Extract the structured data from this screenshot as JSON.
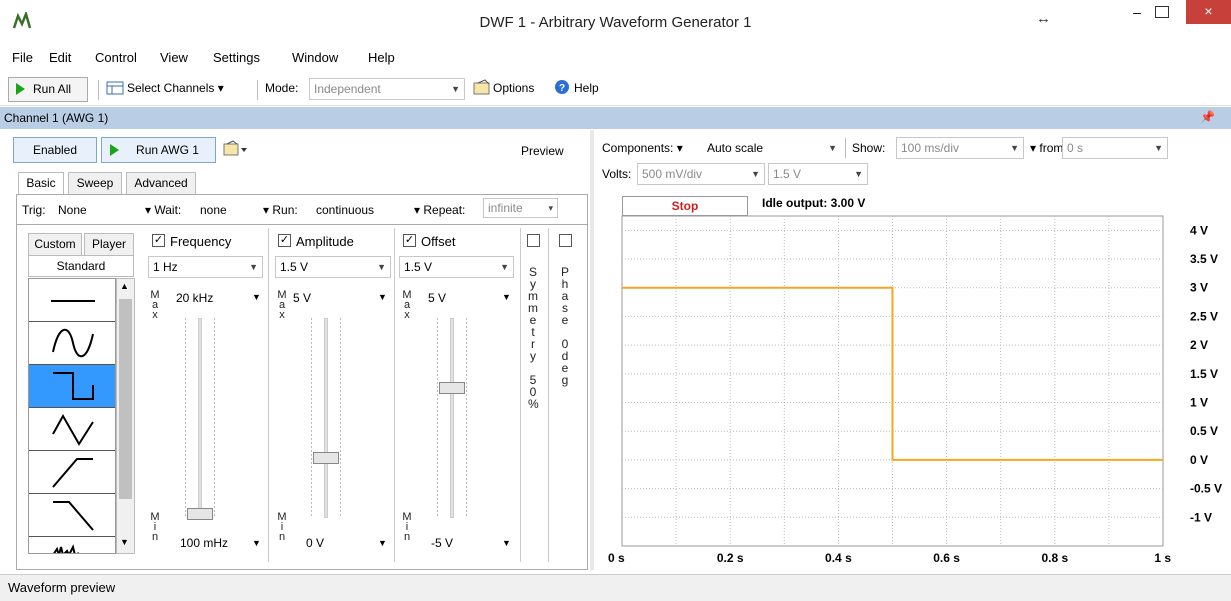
{
  "window": {
    "title": "DWF 1 - Arbitrary Waveform Generator 1",
    "close": "×",
    "resize": "↔",
    "minimize": "–"
  },
  "menu": [
    "File",
    "Edit",
    "Control",
    "View",
    "Settings",
    "Window",
    "Help"
  ],
  "toolbar": {
    "run_all": "Run All",
    "select_channels": "Select Channels",
    "mode_label": "Mode:",
    "mode_value": "Independent",
    "options": "Options",
    "help": "Help"
  },
  "channel": {
    "title": "Channel 1 (AWG 1)",
    "enabled": "Enabled",
    "run": "Run AWG 1",
    "preview": "Preview",
    "tabs": [
      "Basic",
      "Sweep",
      "Advanced"
    ],
    "trig_label": "Trig:",
    "trig_value": "None",
    "wait_label": "Wait:",
    "wait_value": "none",
    "run_label": "Run:",
    "run_value": "continuous",
    "repeat_label": "Repeat:",
    "repeat_value": "infinite",
    "subtabs": [
      "Custom",
      "Player",
      "Standard"
    ],
    "frequency": {
      "label": "Frequency",
      "value": "1 Hz",
      "max": "20 kHz",
      "min": "100 mHz",
      "level": 0.02
    },
    "amplitude": {
      "label": "Amplitude",
      "value": "1.5 V",
      "max": "5 V",
      "min": "0 V",
      "level": 0.3
    },
    "offset": {
      "label": "Offset",
      "value": "1.5 V",
      "max": "5 V",
      "min": "-5 V",
      "level": 0.65
    },
    "max_letters": [
      "M",
      "a",
      "x"
    ],
    "min_letters": [
      "M",
      "i",
      "n"
    ],
    "symmetry_text": [
      "S",
      "y",
      "m",
      "m",
      "e",
      "t",
      "r",
      "y",
      "",
      "5",
      "0",
      "%"
    ],
    "phase_text": [
      "P",
      "h",
      "a",
      "s",
      "e",
      "",
      "0",
      "d",
      "e",
      "g"
    ],
    "waveforms": [
      "dc-icon",
      "sine-icon",
      "square-icon",
      "triangle-icon",
      "ramp-up-icon",
      "ramp-down-icon",
      "noise-icon"
    ]
  },
  "preview_panel": {
    "components_label": "Components:",
    "components_value": "Auto scale",
    "show_label": "Show:",
    "show_value": "100 ms/div",
    "from_label": "from:",
    "from_value": "0 s",
    "volts_label": "Volts:",
    "volts_value": "500 mV/div",
    "volts_offset": "1.5 V",
    "stop": "Stop",
    "idle_output": "Idle output: 3.00 V"
  },
  "chart_data": {
    "type": "line",
    "x": [
      0,
      0.5,
      0.5,
      1.0
    ],
    "series": [
      {
        "values": [
          3.0,
          3.0,
          0.0,
          0.0
        ],
        "color": "#f5a623"
      }
    ],
    "x_ticks": [
      "0 s",
      "0.2 s",
      "0.4 s",
      "0.6 s",
      "0.8 s",
      "1 s"
    ],
    "y_ticks": [
      "4 V",
      "3.5 V",
      "3 V",
      "2.5 V",
      "2 V",
      "1.5 V",
      "1 V",
      "0.5 V",
      "0 V",
      "-0.5 V",
      "-1 V"
    ],
    "xlim": [
      0,
      1
    ],
    "ylim": [
      -1.5,
      4.25
    ],
    "grid": true
  },
  "status": "Waveform preview"
}
